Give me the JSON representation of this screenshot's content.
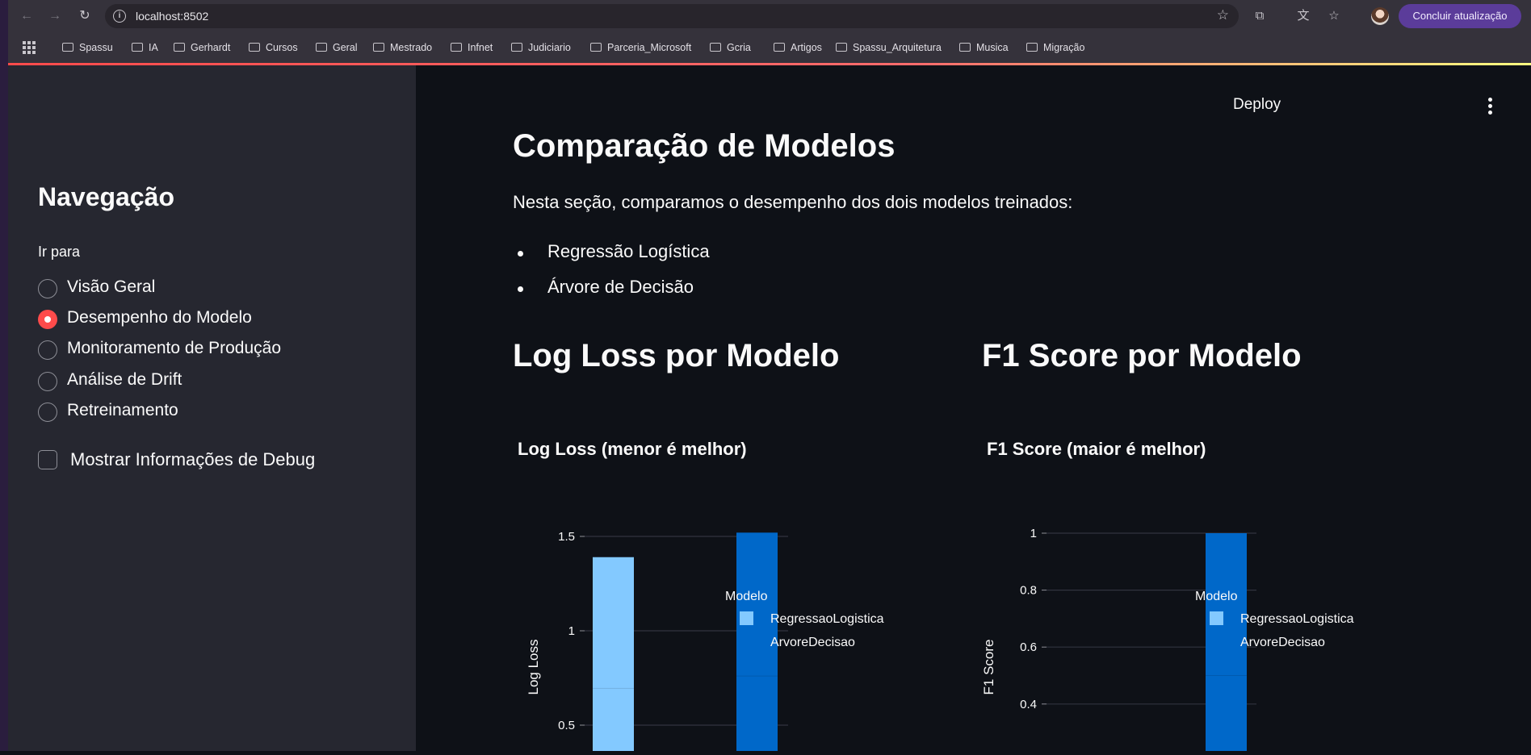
{
  "browser": {
    "url": "localhost:8502",
    "update_button": "Concluir atualização",
    "bookmarks": [
      "Spassu",
      "IA",
      "Gerhardt",
      "Cursos",
      "Geral",
      "Mestrado",
      "Infnet",
      "Judiciario",
      "Parceria_Microsoft",
      "Gcria",
      "Artigos",
      "Spassu_Arquitetura",
      "Musica",
      "Migração"
    ]
  },
  "sidebar": {
    "title": "Navegação",
    "radio_label": "Ir para",
    "options": [
      "Visão Geral",
      "Desempenho do Modelo",
      "Monitoramento de Produção",
      "Análise de Drift",
      "Retreinamento"
    ],
    "selected": "Desempenho do Modelo",
    "debug_checkbox": "Mostrar Informações de Debug",
    "debug_checked": false
  },
  "header": {
    "deploy": "Deploy"
  },
  "main": {
    "title": "Comparação de Modelos",
    "intro": "Nesta seção, comparamos o desempenho dos dois modelos treinados:",
    "bullets": [
      "Regressão Logística",
      "Árvore de Decisão"
    ],
    "logloss_heading": "Log Loss por Modelo",
    "f1_heading": "F1 Score por Modelo"
  },
  "colors": {
    "accent": "#ff4b4b",
    "series1": "#83c9ff",
    "series2": "#0068c9"
  },
  "chart_data": [
    {
      "type": "bar",
      "title": "Log Loss (menor é melhor)",
      "ylabel": "Log Loss",
      "xlabel": "",
      "legend_title": "Modelo",
      "legend_position": "top-right",
      "categories": [
        "RegressaoLogistica",
        "ArvoreDecisao"
      ],
      "values": [
        1.39,
        1.52
      ],
      "yticks": [
        0.5,
        1,
        1.5
      ],
      "ytick_labels": [
        "0.5",
        "1",
        "1.5"
      ],
      "ylim": [
        0,
        1.55
      ],
      "grid": true
    },
    {
      "type": "bar",
      "title": "F1 Score (maior é melhor)",
      "ylabel": "F1 Score",
      "xlabel": "",
      "legend_title": "Modelo",
      "legend_position": "top-right",
      "categories": [
        "RegressaoLogistica",
        "ArvoreDecisao"
      ],
      "values": [
        0,
        1
      ],
      "yticks": [
        0.4,
        0.6,
        0.8,
        1
      ],
      "ytick_labels": [
        "0.4",
        "0.6",
        "0.8",
        "1"
      ],
      "ylim": [
        0,
        1
      ],
      "grid": true
    }
  ]
}
